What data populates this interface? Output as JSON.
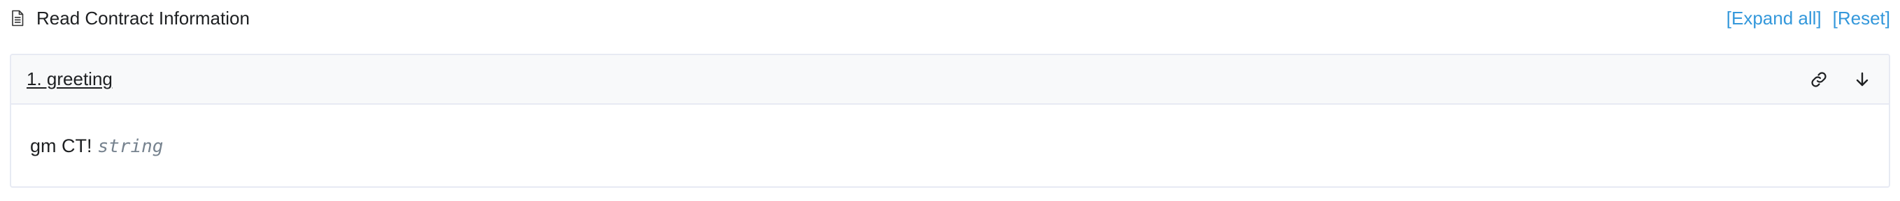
{
  "header": {
    "icon": "document-icon",
    "title": "Read Contract Information",
    "expand_all_label": "[Expand all]",
    "reset_label": "[Reset]"
  },
  "method": {
    "title": "1. greeting",
    "link_icon": "link-icon",
    "expand_icon": "arrow-down-icon",
    "result_value": "gm CT!",
    "result_type": "string"
  },
  "colors": {
    "accent": "#3498db",
    "card_header_bg": "#f8f9fa",
    "border": "#e7eaf3",
    "muted_text": "#77838f"
  }
}
